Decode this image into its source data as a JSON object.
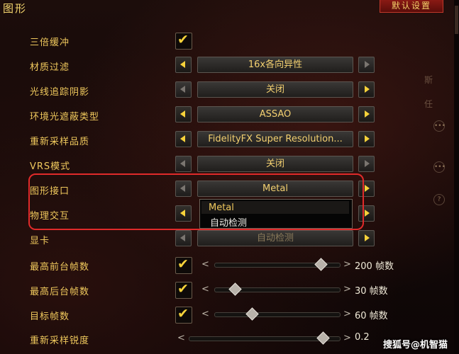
{
  "header": {
    "title": "图形",
    "reset_button": "默认设置"
  },
  "rows": [
    {
      "label": "三倍缓冲"
    },
    {
      "label": "材质过滤",
      "value": "16x各向异性"
    },
    {
      "label": "光线追踪阴影",
      "value": "关闭"
    },
    {
      "label": "环境光遮蔽类型",
      "value": "ASSAO"
    },
    {
      "label": "重新采样品质",
      "value": "FidelityFX Super Resolution..."
    },
    {
      "label": "VRS模式",
      "value": "关闭"
    },
    {
      "label": "图形接口",
      "value": "Metal"
    },
    {
      "label": "物理交互"
    },
    {
      "label": "显卡",
      "value": "自动检测"
    },
    {
      "label": "最高前台帧数",
      "value_text": "200 帧数",
      "level": 0.86
    },
    {
      "label": "最高后台帧数",
      "value_text": "30 帧数",
      "level": 0.13
    },
    {
      "label": "目标帧数",
      "value_text": "60 帧数",
      "level": 0.28
    },
    {
      "label": "重新采样锐度",
      "value_text": "0.2",
      "level": 0.9
    }
  ],
  "dropdown": {
    "options": [
      "Metal",
      "自动检测"
    ],
    "selected": "Metal"
  },
  "side_deco": {
    "top": "斯",
    "mid": "任"
  },
  "watermark": "搜狐号@机智猫",
  "colors": {
    "accent_gold": "#f3cf6a",
    "highlight_red": "#e02a2a",
    "check_yellow": "#f7d23a"
  },
  "icons": [
    "check-icon",
    "arrow-left-icon",
    "arrow-right-icon",
    "slider-knob-icon",
    "more-icon",
    "help-icon"
  ]
}
